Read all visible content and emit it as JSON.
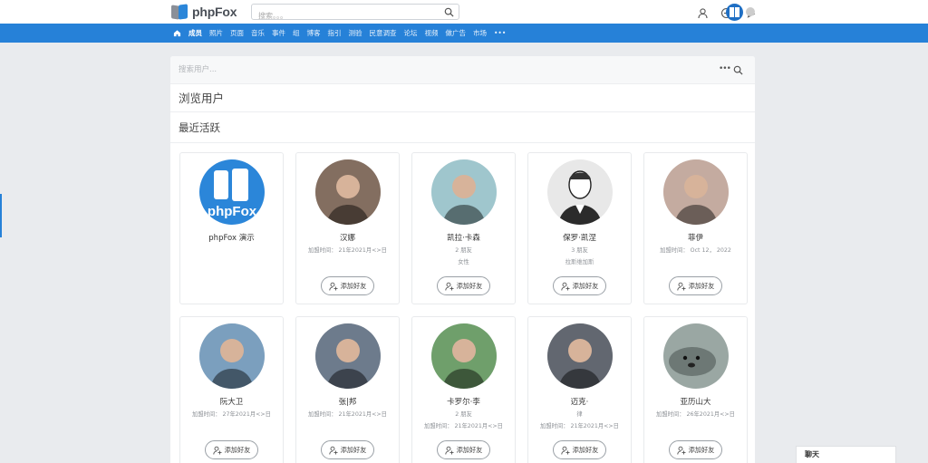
{
  "header": {
    "logo_text": "phpFox",
    "search_placeholder": "搜索。。。"
  },
  "nav": {
    "items": [
      {
        "label": "成员",
        "active": true
      },
      {
        "label": "照片"
      },
      {
        "label": "页面"
      },
      {
        "label": "音乐"
      },
      {
        "label": "事件"
      },
      {
        "label": "组"
      },
      {
        "label": "博客"
      },
      {
        "label": "指引"
      },
      {
        "label": "测验"
      },
      {
        "label": "民意调查"
      },
      {
        "label": "论坛"
      },
      {
        "label": "视频"
      },
      {
        "label": "做广告"
      },
      {
        "label": "市场"
      },
      {
        "label": "•••"
      }
    ]
  },
  "panel": {
    "search_placeholder": "搜索用户...",
    "more_label": "•••",
    "title": "浏览用户",
    "subtitle": "最近活跃"
  },
  "add_friend_label": "添加好友",
  "users": [
    {
      "name": "phpFox 演示",
      "meta1": "",
      "meta2": "",
      "avatar": "logo",
      "color": "#2b86d9",
      "show_button": false
    },
    {
      "name": "汉娜",
      "meta1": "加盟时间： 21年2021月<>日",
      "meta2": "",
      "avatar": "person",
      "color": "#5a3e2b",
      "show_button": true
    },
    {
      "name": "凯拉·卡森",
      "meta1": "2 朋友",
      "meta2": "女性",
      "avatar": "person",
      "color": "#7fb3bd",
      "show_button": true
    },
    {
      "name": "保罗·凯涅",
      "meta1": "3 朋友",
      "meta2": "拉斯维加斯",
      "avatar": "sketch",
      "color": "#d9d9d9",
      "show_button": true
    },
    {
      "name": "菲伊",
      "meta1": "加盟时间： Oct 12， 2022",
      "meta2": "",
      "avatar": "person",
      "color": "#b08f80",
      "show_button": true
    },
    {
      "name": "阮大卫",
      "meta1": "加盟时间： 27年2021月<>日",
      "meta2": "",
      "avatar": "person",
      "color": "#4f7fa8",
      "show_button": true
    },
    {
      "name": "张|邦",
      "meta1": "加盟时间： 21年2021月<>日",
      "meta2": "",
      "avatar": "person",
      "color": "#3d4f66",
      "show_button": true
    },
    {
      "name": "卡罗尔·李",
      "meta1": "2 朋友",
      "meta2": "加盟时间： 21年2021月<>日",
      "avatar": "person",
      "color": "#3f7f3a",
      "show_button": true
    },
    {
      "name": "迈克·",
      "meta1": "律",
      "meta2": "加盟时间： 21年2021月<>日",
      "avatar": "person",
      "color": "#2e3540",
      "show_button": true
    },
    {
      "name": "亚历山大",
      "meta1": "加盟时间： 26年2021月<>日",
      "meta2": "",
      "avatar": "seal",
      "color": "#9aa7a3",
      "show_button": true
    }
  ],
  "chat": {
    "label": "聊天"
  }
}
